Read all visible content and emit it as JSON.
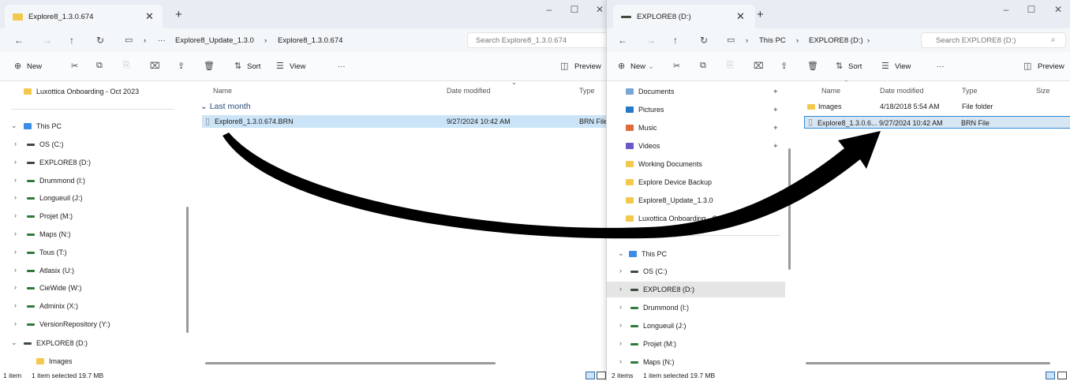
{
  "colors": {
    "folder": "#f2c94c",
    "this_pc": "#3a8ee6",
    "selected": "#cce4f7",
    "accent": "#2b88d8",
    "arrow": "#000000"
  },
  "left": {
    "tab_title": "Explore8_1.3.0.674",
    "address": {
      "overflow": "···",
      "crumbs": [
        "Explore8_Update_1.3.0",
        "Explore8_1.3.0.674"
      ],
      "search_placeholder": "Search Explore8_1.3.0.674"
    },
    "commands": {
      "new": "New",
      "sort": "Sort",
      "view": "View",
      "more": "···",
      "preview": "Preview"
    },
    "nav": {
      "pinned_item": "Luxottica Onboarding - Oct 2023",
      "this_pc": "This PC",
      "drives": [
        "OS (C:)",
        "EXPLORE8 (D:)",
        "Drummond (I:)",
        "Longueuil (J:)",
        "Projet (M:)",
        "Maps (N:)",
        "Tous (T:)",
        "Atlasix (U:)",
        "CieWide (W:)",
        "Adminix (X:)",
        "VersionRepository (Y:)"
      ],
      "expanded_drive": "EXPLORE8 (D:)",
      "child": "Images"
    },
    "columns": {
      "name": "Name",
      "date": "Date modified",
      "type": "Type"
    },
    "group": "Last month",
    "files": [
      {
        "name": "Explore8_1.3.0.674.BRN",
        "date": "9/27/2024 10:42 AM",
        "type": "BRN File"
      }
    ],
    "status": {
      "count": "1 item",
      "selection": "1 item selected  19.7 MB"
    }
  },
  "right": {
    "tab_title": "EXPLORE8 (D:)",
    "address": {
      "crumbs": [
        "This PC",
        "EXPLORE8 (D:)"
      ],
      "search_placeholder": "Search EXPLORE8 (D:)"
    },
    "commands": {
      "new": "New",
      "sort": "Sort",
      "view": "View",
      "more": "···",
      "preview": "Preview"
    },
    "nav": {
      "quick_access": [
        "Documents",
        "Pictures",
        "Music",
        "Videos",
        "Working Documents",
        "Explore Device Backup",
        "Explore8_Update_1.3.0",
        "Luxottica Onboarding - Oct 2023"
      ],
      "this_pc": "This PC",
      "drives": [
        "OS (C:)",
        "EXPLORE8 (D:)",
        "Drummond (I:)",
        "Longueuil (J:)",
        "Projet (M:)",
        "Maps (N:)"
      ]
    },
    "columns": {
      "name": "Name",
      "date": "Date modified",
      "type": "Type",
      "size": "Size"
    },
    "files": [
      {
        "name": "Images",
        "date": "4/18/2018 5:54 AM",
        "type": "File folder"
      },
      {
        "name": "Explore8_1.3.0.6...",
        "date": "9/27/2024 10:42 AM",
        "type": "BRN File"
      }
    ],
    "status": {
      "count": "2 items",
      "selection": "1 item selected  19.7 MB"
    }
  }
}
